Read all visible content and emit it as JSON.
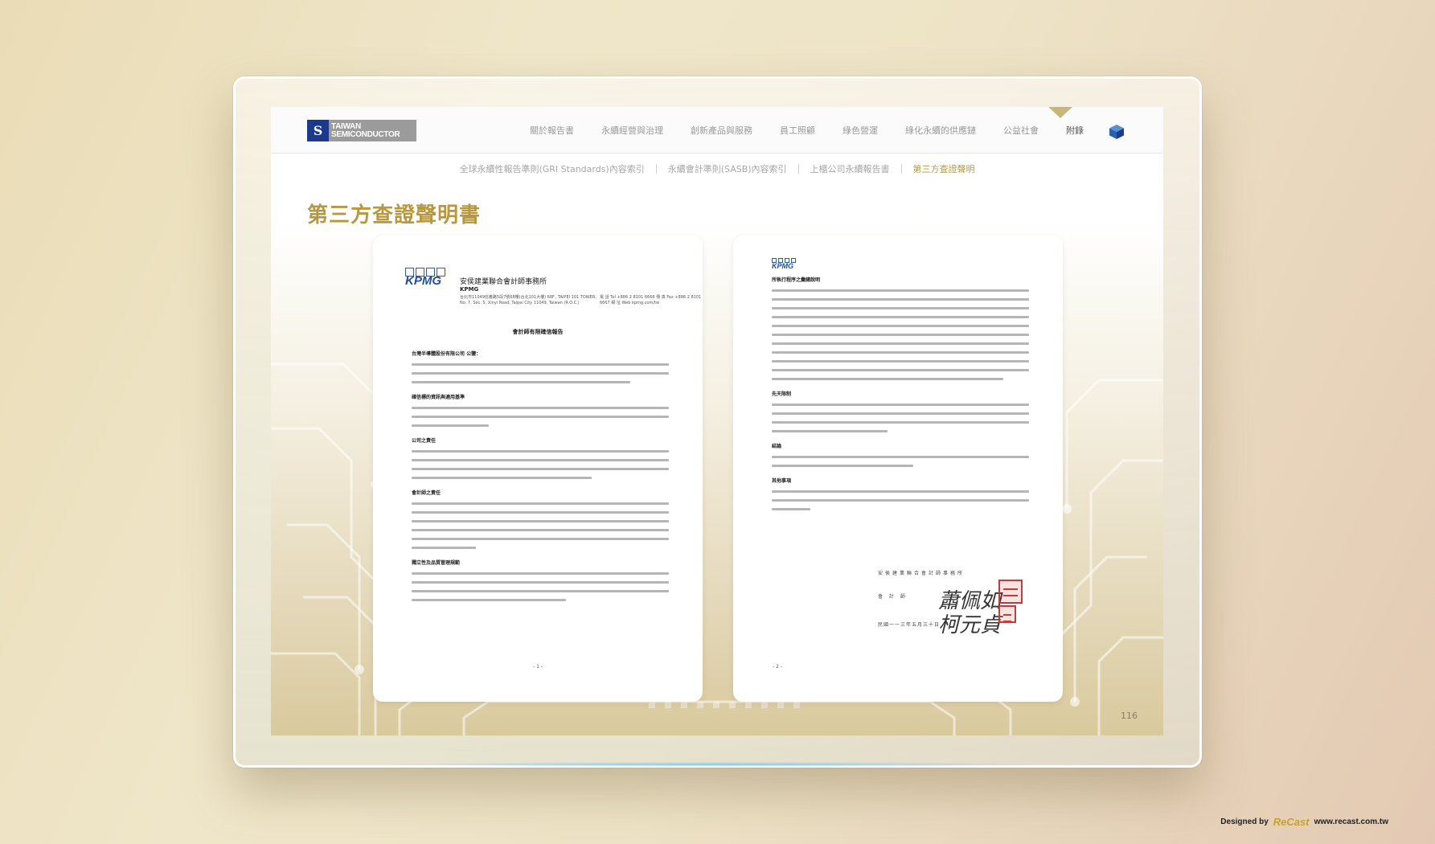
{
  "header": {
    "logo_mark": "S",
    "logo_line1": "TAIWAN",
    "logo_line2": "SEMICONDUCTOR",
    "nav": [
      "關於報告書",
      "永續經營與治理",
      "創新產品與服務",
      "員工照顧",
      "綠色營運",
      "綠化永續的供應鏈",
      "公益社會",
      "附錄"
    ],
    "active_nav": "附錄"
  },
  "subnav": {
    "items": [
      "全球永續性報告準則(GRI Standards)內容索引",
      "永續會計準則(SASB)內容索引",
      "上櫃公司永續報告書",
      "第三方查證聲明"
    ],
    "active": "第三方查證聲明"
  },
  "page": {
    "title": "第三方查證聲明書",
    "page_number": "116"
  },
  "doc_left": {
    "logo": "KPMG",
    "firm_cn": "安侯建業聯合會計師事務所",
    "firm_en": "KPMG",
    "address": "台北市11049信義路5段7號68樓(台北101大樓) 68F., TAIPEI 101 TOWER, No. 7, Sec. 5, Xinyi Road, Taipei City 11049, Taiwan (R.O.C.)",
    "contact": "電 話 Tel +886 2 8101 6666 傳 真 Fax +886 2 8101 6667 網 址 Web kpmg.com/tw",
    "heading": "會計師有限確信報告",
    "addressee": "台灣半導體股份有限公司 公鑒：",
    "sections": [
      "確信標的資訊與適用基準",
      "公司之責任",
      "會計師之責任",
      "獨立性及品質管理規範"
    ],
    "page_mark": "- 1 -"
  },
  "doc_right": {
    "logo": "KPMG",
    "sections": [
      "所執行程序之彙總說明",
      "先天限制",
      "結論",
      "其他事項"
    ],
    "sign_firm": "安侯建業聯合會計師事務所",
    "sign_label": "會 計 師",
    "signature": "蕭佩如\n柯元貞",
    "date": "民國一一三年五月三十日"
  },
  "credit": {
    "designed_by": "Designed by",
    "brand": "ReCast",
    "url": "www.recast.com.tw"
  }
}
